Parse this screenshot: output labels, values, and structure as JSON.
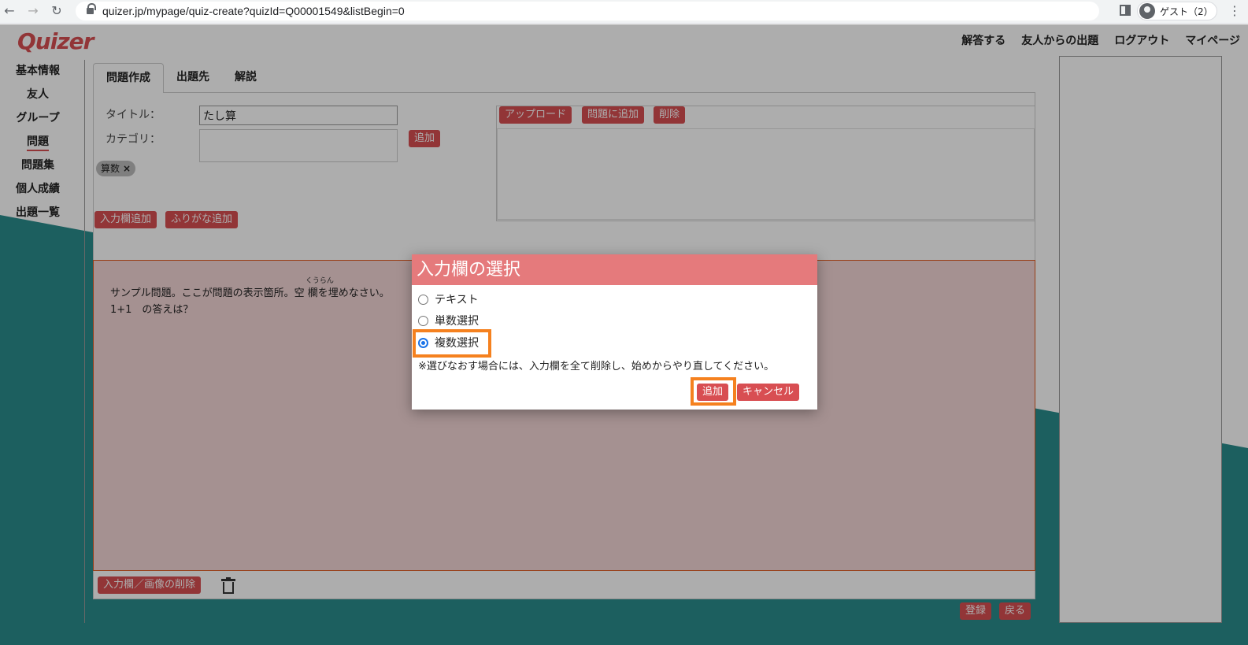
{
  "browser": {
    "url": "quizer.jp/mypage/quiz-create?quizId=Q00001549&listBegin=0",
    "profile_name": "ゲスト（2）"
  },
  "header": {
    "logo": "Quizer",
    "nav": [
      "解答する",
      "友人からの出題",
      "ログアウト",
      "マイページ"
    ]
  },
  "sidebar": {
    "items": [
      {
        "label": "基本情報"
      },
      {
        "label": "友人"
      },
      {
        "label": "グループ"
      },
      {
        "label": "問題"
      },
      {
        "label": "問題集"
      },
      {
        "label": "個人成績"
      },
      {
        "label": "出題一覧"
      }
    ]
  },
  "tabs": [
    "問題作成",
    "出題先",
    "解説"
  ],
  "form": {
    "title_label": "タイトル：",
    "title_value": "たし算",
    "category_label": "カテゴリ：",
    "add_category_button": "追加",
    "tag": "算数",
    "upload_button": "アップロード",
    "add_to_question_button": "問題に追加",
    "delete_button": "削除",
    "add_input_button": "入力欄追加",
    "add_furigana_button": "ふりがな追加"
  },
  "question": {
    "line1_a": "サンプル問題。ここが問題の表示箇所。",
    "line1_b": "空",
    "line1_c": "欄を埋めなさい。",
    "ruby": "くうらん",
    "line2": "1+1　の答えは？"
  },
  "footer": {
    "delete_input_image_button": "入力欄／画像の削除",
    "register_button": "登録",
    "back_button": "戻る"
  },
  "modal": {
    "title": "入力欄の選択",
    "options": [
      "テキスト",
      "単数選択",
      "複数選択"
    ],
    "selected": "複数選択",
    "note": "※選びなおす場合には、入力欄を全て削除し、始めからやり直してください。",
    "add_button": "追加",
    "cancel_button": "キャンセル"
  },
  "colors": {
    "accent": "#d84e52",
    "modal_header": "#e57a7c",
    "teal": "#2a8c8c",
    "highlight": "#f5811f"
  }
}
